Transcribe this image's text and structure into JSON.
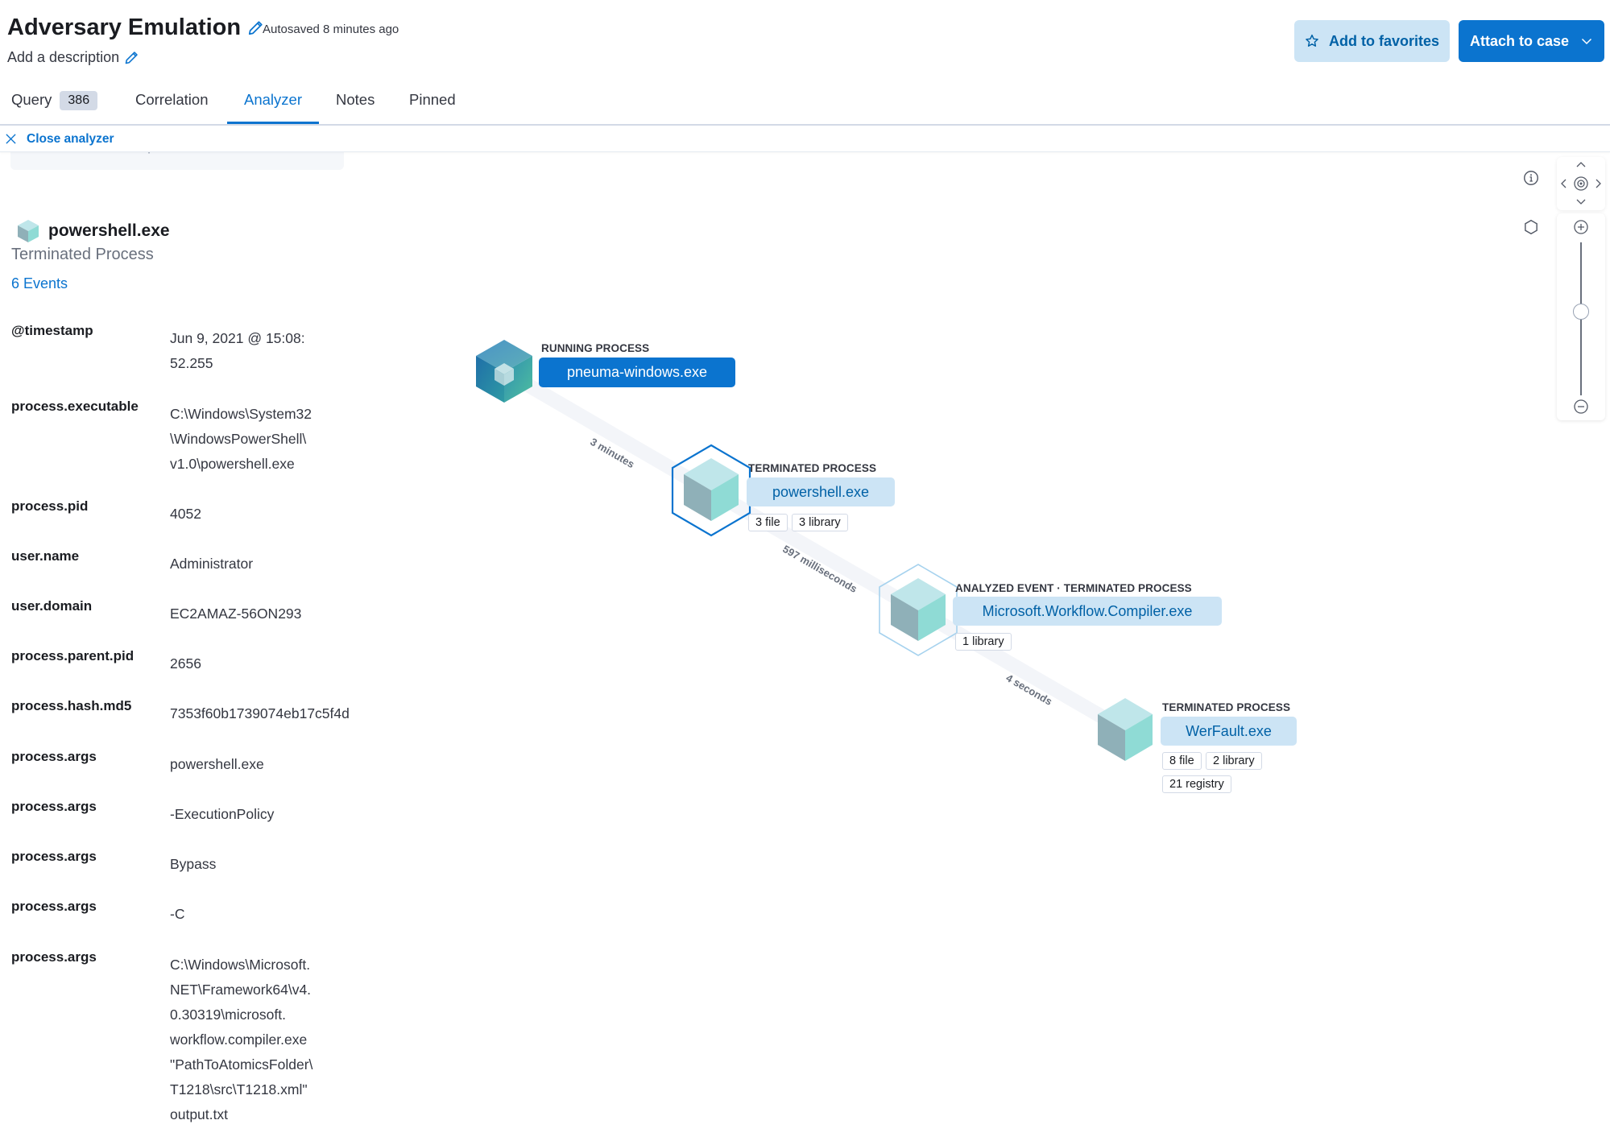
{
  "header": {
    "title": "Adversary Emulation",
    "autosaved": "Autosaved 8 minutes ago",
    "description_placeholder": "Add a description",
    "favorites_button": "Add to favorites",
    "attach_button": "Attach to case"
  },
  "tabs": [
    {
      "label": "Query",
      "badge": "386",
      "active": false
    },
    {
      "label": "Correlation",
      "active": false
    },
    {
      "label": "Analyzer",
      "active": true
    },
    {
      "label": "Notes",
      "active": false
    },
    {
      "label": "Pinned",
      "active": false
    }
  ],
  "close_analyzer": "Close analyzer",
  "panel": {
    "breadcrumb": "Events / Details for: powershell....",
    "process_name": "powershell.exe",
    "process_state": "Terminated Process",
    "events_link": "6 Events",
    "fields": [
      {
        "key": "@timestamp",
        "value": "Jun 9, 2021 @ 15:08:\n52.255"
      },
      {
        "key": "process.executable",
        "value": "C:\\Windows\\System32\n\\WindowsPowerShell\\\nv1.0\\powershell.exe"
      },
      {
        "key": "process.pid",
        "value": "4052"
      },
      {
        "key": "user.name",
        "value": "Administrator"
      },
      {
        "key": "user.domain",
        "value": "EC2AMAZ-56ON293"
      },
      {
        "key": "process.parent.pid",
        "value": "2656"
      },
      {
        "key": "process.hash.md5",
        "value": "7353f60b1739074eb17c5f4d"
      },
      {
        "key": "process.args",
        "value": "powershell.exe"
      },
      {
        "key": "process.args",
        "value": "-ExecutionPolicy"
      },
      {
        "key": "process.args",
        "value": "Bypass"
      },
      {
        "key": "process.args",
        "value": "-C"
      },
      {
        "key": "process.args",
        "value": "C:\\Windows\\Microsoft.\nNET\\Framework64\\v4.\n0.30319\\microsoft.\nworkflow.compiler.exe\n\"PathToAtomicsFolder\\\nT1218\\src\\T1218.xml\"\noutput.txt"
      }
    ]
  },
  "graph": {
    "nodes": [
      {
        "state": "RUNNING PROCESS",
        "name": "pneuma-windows.exe",
        "style": "primary",
        "pills": []
      },
      {
        "state": "TERMINATED PROCESS",
        "name": "powershell.exe",
        "style": "secondary",
        "selected": true,
        "pills": [
          "3 file",
          "3 library"
        ]
      },
      {
        "state": "ANALYZED EVENT · TERMINATED PROCESS",
        "name": "Microsoft.Workflow.Compiler.exe",
        "style": "secondary",
        "pills": [
          "1 library"
        ]
      },
      {
        "state": "TERMINATED PROCESS",
        "name": "WerFault.exe",
        "style": "secondary",
        "pills": [
          "8 file",
          "2 library",
          "21 registry"
        ]
      }
    ],
    "edges": [
      {
        "label": "3 minutes"
      },
      {
        "label": "597 milliseconds"
      },
      {
        "label": "4 seconds"
      }
    ]
  },
  "controls": {
    "zoom_level": 0.55,
    "icons": [
      "info-icon",
      "schema-hexagon-icon",
      "pan-up-icon",
      "pan-left-icon",
      "center-icon",
      "pan-right-icon",
      "pan-down-icon",
      "zoom-in-icon",
      "zoom-out-icon"
    ]
  },
  "colors": {
    "accent": "#0b74cf",
    "accent_light": "#cce4f5",
    "text_dark": "#1a1c21",
    "text_muted": "#69707d",
    "cube_light": "#8fdbd5",
    "cube_running": "#2f8fb0"
  }
}
